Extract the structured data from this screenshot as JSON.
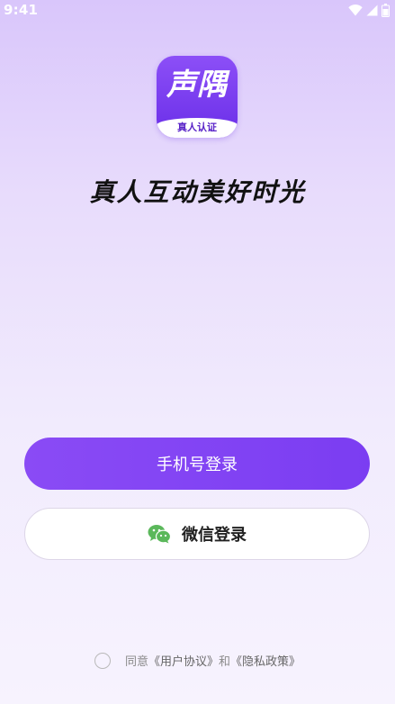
{
  "status_bar": {
    "time": "9:41",
    "icons": [
      "wifi-icon",
      "signal-icon",
      "battery-icon"
    ]
  },
  "app": {
    "logo_title": "声隅",
    "logo_badge": "真人认证",
    "slogan": "真人互动美好时光"
  },
  "buttons": {
    "phone_login": "手机号登录",
    "wechat_login": "微信登录"
  },
  "agreement": {
    "prefix": "同意",
    "user_agreement": "《用户协议》",
    "conjunction": "和",
    "privacy_policy": "《隐私政策》"
  },
  "colors": {
    "primary": "#7b3df2",
    "wechat_green": "#5bb85b"
  }
}
